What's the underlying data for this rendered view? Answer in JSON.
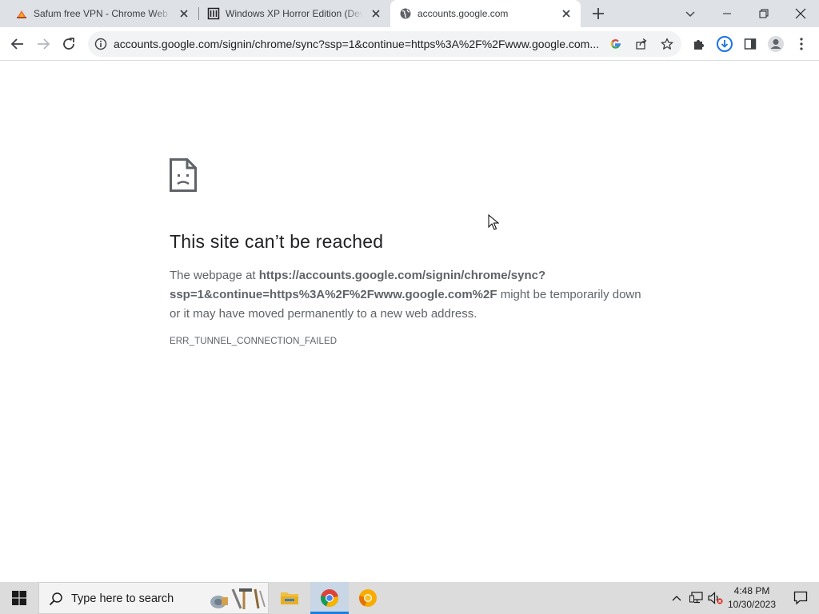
{
  "browser": {
    "tabs": [
      {
        "title": "Safum free VPN - Chrome Web Store",
        "favicon": "safum-vpn-icon",
        "active": false
      },
      {
        "title": "Windows XP Horror Edition (Deviantart)",
        "favicon": "museum-icon",
        "active": false
      },
      {
        "title": "accounts.google.com",
        "favicon": "globe-icon",
        "active": true
      }
    ],
    "address_bar": {
      "url": "accounts.google.com/signin/chrome/sync?ssp=1&continue=https%3A%2F%2Fwww.google.com..."
    }
  },
  "page": {
    "title": "This site can’t be reached",
    "desc_prefix": "The webpage at ",
    "desc_url_line1": "https://accounts.google.com/signin/chrome/sync?",
    "desc_url_line2": "ssp=1&continue=https%3A%2F%2Fwww.google.com%2F",
    "desc_suffix": " might be temporarily down or it may have moved permanently to a new web address.",
    "error_code": "ERR_TUNNEL_CONNECTION_FAILED"
  },
  "taskbar": {
    "search_placeholder": "Type here to search",
    "apps": [
      "file-explorer-icon",
      "chrome-icon",
      "chrome-canary-icon"
    ],
    "clock_time": "4:48 PM",
    "clock_date": "10/30/2023"
  },
  "colors": {
    "tabstrip": "#dee1e6",
    "omnibox": "#f1f3f4",
    "text_primary": "#202124",
    "text_secondary": "#5f6368",
    "download_accent": "#1a73e8",
    "taskbar": "#dcdcdc"
  }
}
